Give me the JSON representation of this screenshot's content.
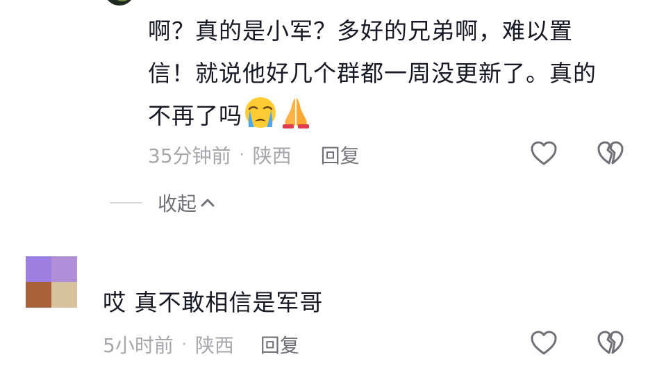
{
  "reply": {
    "text_line1": "啊？真的是小军？多好的兄弟啊，难以置",
    "text_line2": "信！就说他好几个群都一周没更新了。真的",
    "text_line3": "不再了吗",
    "emojis": [
      "crying-face-emoji",
      "praying-hands-emoji"
    ],
    "time": "35分钟前",
    "separator": "·",
    "location": "陕西",
    "reply_label": "回复"
  },
  "collapse": {
    "label": "收起"
  },
  "comment": {
    "username": "",
    "text": "哎 真不敢相信是军哥",
    "time": "5小时前",
    "separator": "·",
    "location": "陕西",
    "reply_label": "回复",
    "avatar_colors": [
      "#9c7fe0",
      "#b08fd8",
      "#a8613a",
      "#d8c29e"
    ]
  },
  "icons": {
    "like": "heart-outline-icon",
    "dislike": "broken-heart-outline-icon"
  },
  "colors": {
    "text": "#161823",
    "meta": "#a6a6ab",
    "action": "#6f7076"
  }
}
